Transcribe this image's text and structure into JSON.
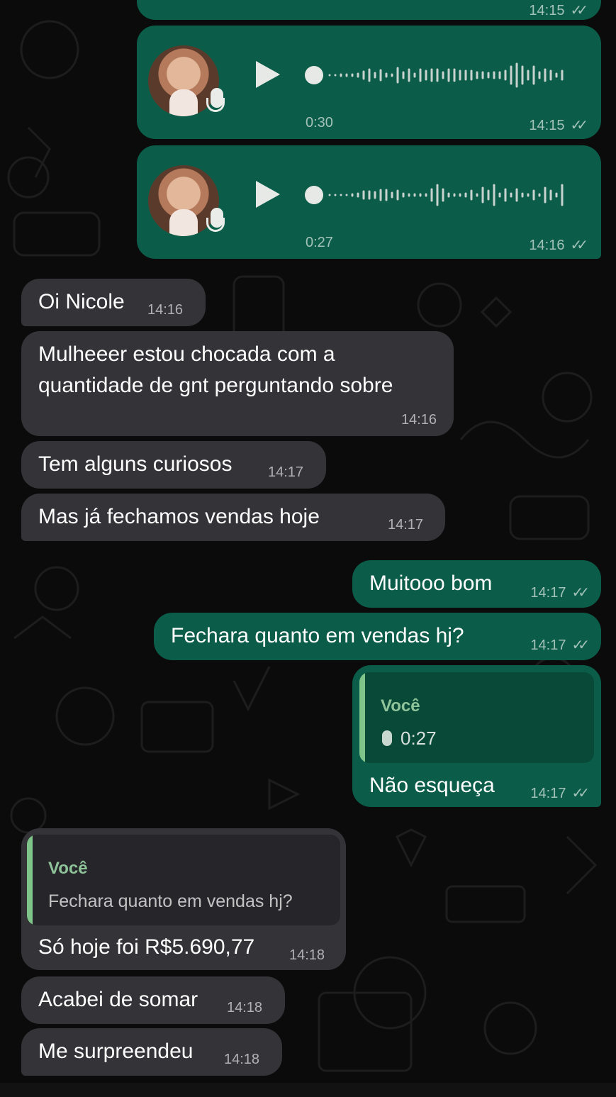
{
  "colors": {
    "background": "#0b0b0b",
    "outgoing_bubble": "#0b5c48",
    "incoming_bubble": "#333338",
    "quote_accent": "#7fc58a"
  },
  "messages": {
    "top_partial_time": "14:15",
    "voice1": {
      "duration": "0:30",
      "time": "14:15",
      "icon": "play-icon",
      "status": "read-ticks-icon"
    },
    "voice2": {
      "duration": "0:27",
      "time": "14:16",
      "icon": "play-icon",
      "status": "read-ticks-icon"
    },
    "in1": {
      "text": "Oi Nicole",
      "time": "14:16"
    },
    "in2": {
      "text": "Mulheeer estou chocada com a quantidade de gnt perguntando sobre",
      "time": "14:16"
    },
    "in3": {
      "text": "Tem alguns curiosos",
      "time": "14:17"
    },
    "in4": {
      "text": "Mas já fechamos vendas hoje",
      "time": "14:17"
    },
    "out1": {
      "text": "Muitooo bom",
      "time": "14:17"
    },
    "out2": {
      "text": "Fechara quanto em vendas hj?",
      "time": "14:17"
    },
    "out3": {
      "quote_author": "Você",
      "quote_body": "0:27",
      "text": "Não esqueça",
      "time": "14:17"
    },
    "in5": {
      "quote_author": "Você",
      "quote_body": "Fechara quanto em vendas hj?",
      "text": "Só hoje foi R$5.690,77",
      "time": "14:18"
    },
    "in6": {
      "text": "Acabei de somar",
      "time": "14:18"
    },
    "in7": {
      "text": "Me surpreendeu",
      "time": "14:18"
    }
  }
}
